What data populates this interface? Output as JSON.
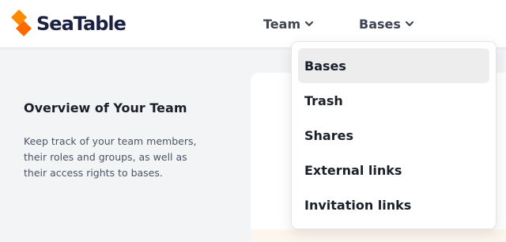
{
  "header": {
    "logo_text": "SeaTable",
    "brand_color": "#ff8000",
    "nav": [
      {
        "label": "Team",
        "icon": "chevron-down-icon"
      },
      {
        "label": "Bases",
        "icon": "chevron-down-icon"
      }
    ]
  },
  "main": {
    "overview_title": "Overview of Your Team",
    "overview_description": "Keep track of your team members, their roles and groups, as well as their access rights to bases."
  },
  "dropdown": {
    "items": [
      {
        "label": "Bases",
        "active": true
      },
      {
        "label": "Trash",
        "active": false
      },
      {
        "label": "Shares",
        "active": false
      },
      {
        "label": "External links",
        "active": false
      },
      {
        "label": "Invitation links",
        "active": false
      }
    ]
  }
}
